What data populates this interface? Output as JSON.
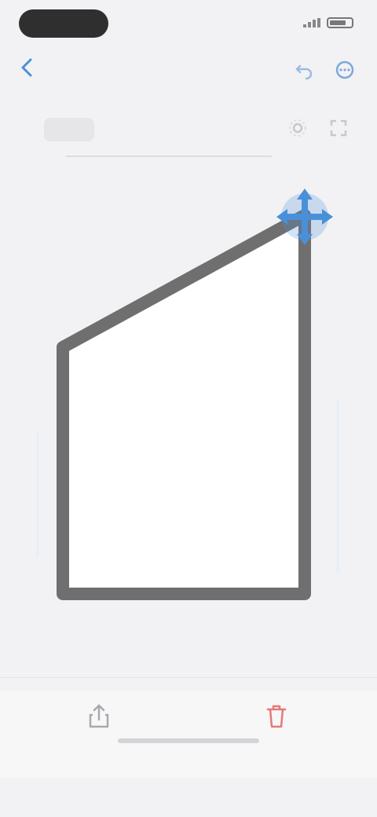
{
  "status_bar": {
    "time": ""
  },
  "nav": {
    "back_label": "",
    "title": ""
  },
  "toolbar": {
    "left_chip": ""
  },
  "shape": {
    "outline_color": "#6f6f6f",
    "fill_color": "#ffffff",
    "handle_color": "#4a90d9",
    "dimension_label": ""
  },
  "bottom_bar": {
    "share_label": "",
    "delete_label": ""
  },
  "icons": {
    "back": "chevron-left-icon",
    "nav_actions": [
      "undo-icon",
      "more-icon"
    ],
    "toolbar": [
      "settings-icon",
      "expand-icon"
    ],
    "handle": "move-arrows-icon",
    "bottom": [
      "share-icon",
      "trash-icon"
    ]
  }
}
